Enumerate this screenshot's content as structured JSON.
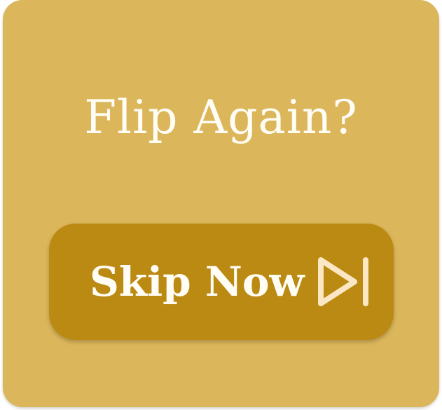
{
  "dialog": {
    "title": "Flip Again?",
    "skip_button_label": "Skip Now",
    "skip_icon": "skip-forward-icon"
  },
  "colors": {
    "card_background": "#dbb65a",
    "button_background": "#bb8a12",
    "text": "#fffdf5",
    "icon": "#fbe7c4"
  }
}
